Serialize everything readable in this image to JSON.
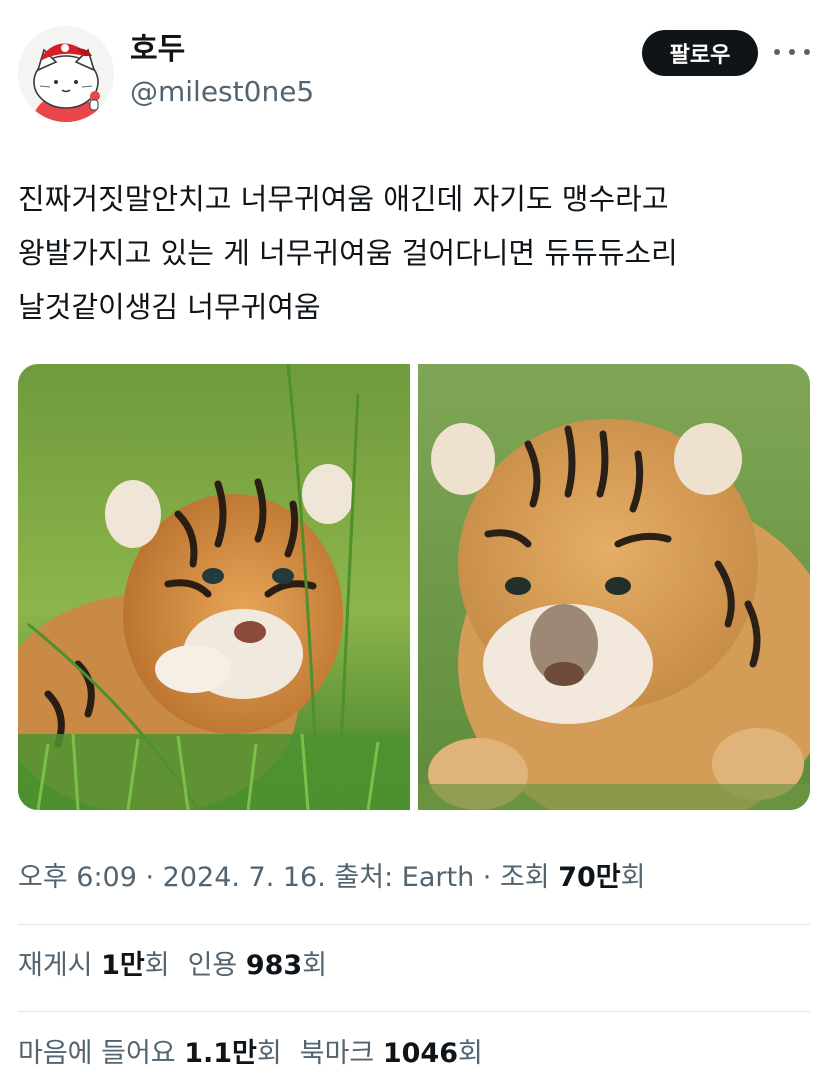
{
  "author": {
    "display_name": "호두",
    "handle": "@milest0ne5",
    "follow_label": "팔로우"
  },
  "tweet": {
    "lines": [
      "진짜거짓말안치고 너무귀여움  애긴데  자기도 맹수라고",
      "왕발가지고 있는 게 너무귀여움  걸어다니면 듀듀듀소리",
      "날것같이생김  너무귀여움"
    ]
  },
  "media": [
    {
      "name": "tiger-cub-photo-left"
    },
    {
      "name": "tiger-cub-photo-right"
    }
  ],
  "meta": {
    "time": "오후 6:09",
    "sep1": " · ",
    "date": "2024. 7. 16.",
    "sep2": " ",
    "source_label": "출처: ",
    "source_value": "Earth",
    "sep3": " · ",
    "views_label": "조회 ",
    "views_value": "70만",
    "views_suffix": "회"
  },
  "stats_row1": {
    "retweets_label": "재게시 ",
    "retweets_value": "1만",
    "retweets_suffix": "회",
    "quotes_label": "인용 ",
    "quotes_value": "983",
    "quotes_suffix": "회"
  },
  "stats_row2": {
    "likes_label": "마음에 들어요 ",
    "likes_value": "1.1만",
    "likes_suffix": "회",
    "bookmarks_label": "북마크 ",
    "bookmarks_value": "1046",
    "bookmarks_suffix": "회"
  }
}
